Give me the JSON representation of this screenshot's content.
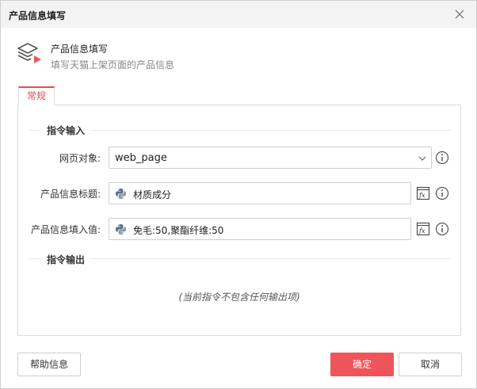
{
  "window": {
    "title": "产品信息填写"
  },
  "header": {
    "title": "产品信息填写",
    "subtitle": "填写天猫上架页面的产品信息",
    "icon": "layers-play-icon"
  },
  "tabs": [
    {
      "label": "常规",
      "active": true
    }
  ],
  "sections": {
    "input": "指令输入",
    "output": "指令输出"
  },
  "fields": {
    "web_object": {
      "label": "网页对象:",
      "value": "web_page"
    },
    "product_title": {
      "label": "产品信息标题:",
      "value": "材质成分"
    },
    "product_value": {
      "label": "产品信息填入值:",
      "value": "免毛:50,聚酯纤维:50"
    }
  },
  "output_note": "(当前指令不包含任何输出项)",
  "buttons": {
    "help": "帮助信息",
    "ok": "确定",
    "cancel": "取消"
  },
  "colors": {
    "accent": "#f0545b",
    "tab_accent": "#e84a50",
    "python_blue": "#5b6f8a"
  }
}
